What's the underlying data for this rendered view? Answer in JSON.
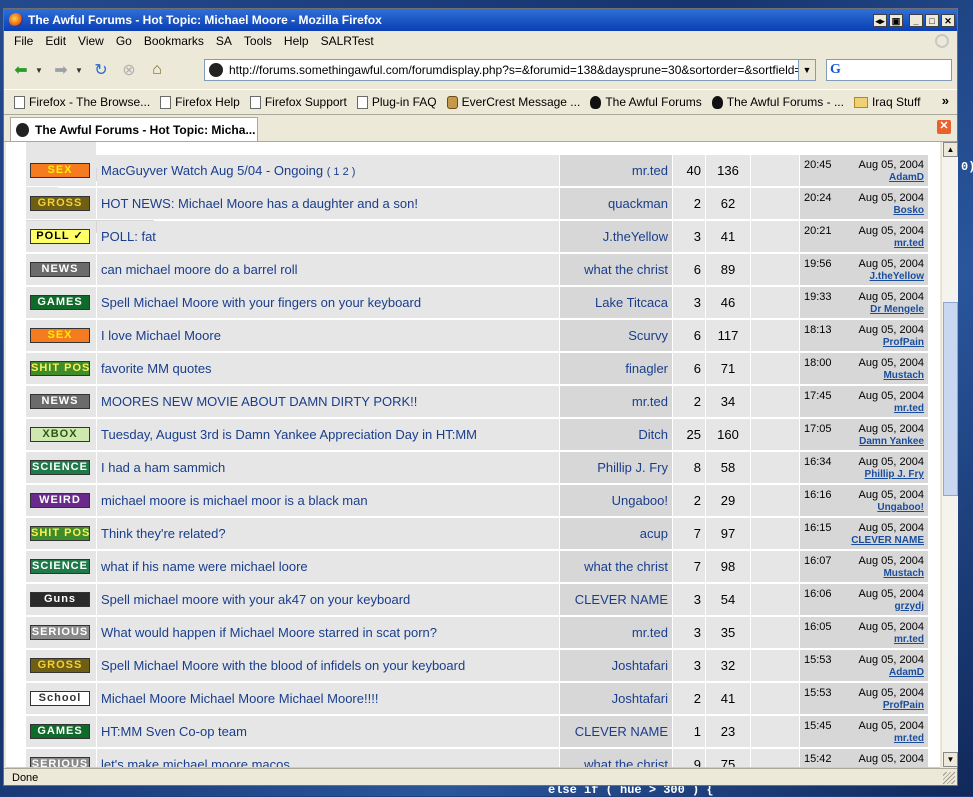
{
  "window": {
    "title": "The Awful Forums - Hot Topic: Michael Moore - Mozilla Firefox"
  },
  "menu": [
    "File",
    "Edit",
    "View",
    "Go",
    "Bookmarks",
    "SA",
    "Tools",
    "Help",
    "SALRTest"
  ],
  "address": {
    "url": "http://forums.somethingawful.com/forumdisplay.php?s=&forumid=138&daysprune=30&sortorder=&sortfield=lastpos"
  },
  "search": {
    "engine": "G"
  },
  "bookmarks": [
    "Firefox - The Browse...",
    "Firefox Help",
    "Firefox Support",
    "Plug-in FAQ",
    "EverCrest Message ...",
    "The Awful Forums",
    "The Awful Forums - ...",
    "Iraq Stuff"
  ],
  "tab": {
    "title": "The Awful Forums - Hot Topic: Micha..."
  },
  "threads": [
    {
      "icon": "SEX",
      "icon_bg": "#f47b20",
      "icon_fg": "#ffee00",
      "title": "MacGuyver Watch Aug 5/04 - Ongoing",
      "pages": "( 1 2 )",
      "user": "mr.ted",
      "replies": "40",
      "views": "136",
      "time": "20:45",
      "date": "Aug 05, 2004",
      "last": "AdamD"
    },
    {
      "icon": "GROSS",
      "icon_bg": "#6f5f12",
      "icon_fg": "#f2d23a",
      "title": "HOT NEWS: Michael Moore has a daughter and a son!",
      "pages": "",
      "user": "quackman",
      "replies": "2",
      "views": "62",
      "time": "20:24",
      "date": "Aug 05, 2004",
      "last": "Bosko"
    },
    {
      "icon": "POLL ✓",
      "icon_bg": "#ffff66",
      "icon_fg": "#000000",
      "title": "POLL: fat",
      "pages": "",
      "user": "J.theYellow",
      "replies": "3",
      "views": "41",
      "time": "20:21",
      "date": "Aug 05, 2004",
      "last": "mr.ted"
    },
    {
      "icon": "NEWS",
      "icon_bg": "#6b6b6b",
      "icon_fg": "#ffffff",
      "title": "can michael moore do a barrel roll",
      "pages": "",
      "user": "what the christ",
      "replies": "6",
      "views": "89",
      "time": "19:56",
      "date": "Aug 05, 2004",
      "last": "J.theYellow"
    },
    {
      "icon": "GAMES",
      "icon_bg": "#0f6b2a",
      "icon_fg": "#ffffff",
      "title": "Spell Michael Moore with your fingers on your keyboard",
      "pages": "",
      "user": "Lake Titcaca",
      "replies": "3",
      "views": "46",
      "time": "19:33",
      "date": "Aug 05, 2004",
      "last": "Dr Mengele"
    },
    {
      "icon": "SEX",
      "icon_bg": "#f47b20",
      "icon_fg": "#ffee00",
      "title": "I love Michael Moore",
      "pages": "",
      "user": "Scurvy",
      "replies": "6",
      "views": "117",
      "time": "18:13",
      "date": "Aug 05, 2004",
      "last": "ProfPain"
    },
    {
      "icon": "SHIT POST",
      "icon_bg": "#3f8c2a",
      "icon_fg": "#ffee55",
      "title": "favorite MM quotes",
      "pages": "",
      "user": "finagler",
      "replies": "6",
      "views": "71",
      "time": "18:00",
      "date": "Aug 05, 2004",
      "last": "Mustach"
    },
    {
      "icon": "NEWS",
      "icon_bg": "#6b6b6b",
      "icon_fg": "#ffffff",
      "title": "MOORES NEW MOVIE ABOUT DAMN DIRTY PORK!!",
      "pages": "",
      "user": "mr.ted",
      "replies": "2",
      "views": "34",
      "time": "17:45",
      "date": "Aug 05, 2004",
      "last": "mr.ted"
    },
    {
      "icon": "XBOX",
      "icon_bg": "#cfe8b0",
      "icon_fg": "#2a5a10",
      "title": "Tuesday, August 3rd is Damn Yankee Appreciation Day in HT:MM",
      "pages": "",
      "user": "Ditch",
      "replies": "25",
      "views": "160",
      "time": "17:05",
      "date": "Aug 05, 2004",
      "last": "Damn Yankee"
    },
    {
      "icon": "SCIENCE",
      "icon_bg": "#1f7a4a",
      "icon_fg": "#ffffff",
      "title": "I had a ham sammich",
      "pages": "",
      "user": "Phillip J. Fry",
      "replies": "8",
      "views": "58",
      "time": "16:34",
      "date": "Aug 05, 2004",
      "last": "Phillip J. Fry"
    },
    {
      "icon": "WEIRD",
      "icon_bg": "#6a2a8c",
      "icon_fg": "#ffffff",
      "title": "michael moore is michael moor is a black man",
      "pages": "",
      "user": "Ungaboo!",
      "replies": "2",
      "views": "29",
      "time": "16:16",
      "date": "Aug 05, 2004",
      "last": "Ungaboo!"
    },
    {
      "icon": "SHIT POST",
      "icon_bg": "#3f8c2a",
      "icon_fg": "#ffee55",
      "title": "Think they're related?",
      "pages": "",
      "user": "acup",
      "replies": "7",
      "views": "97",
      "time": "16:15",
      "date": "Aug 05, 2004",
      "last": "CLEVER NAME"
    },
    {
      "icon": "SCIENCE",
      "icon_bg": "#1f7a4a",
      "icon_fg": "#ffffff",
      "title": "what if his name were michael loore",
      "pages": "",
      "user": "what the christ",
      "replies": "7",
      "views": "98",
      "time": "16:07",
      "date": "Aug 05, 2004",
      "last": "Mustach"
    },
    {
      "icon": "Guns",
      "icon_bg": "#2a2a2a",
      "icon_fg": "#ffffff",
      "title": "Spell michael moore with your ak47 on your keyboard",
      "pages": "",
      "user": "CLEVER NAME",
      "replies": "3",
      "views": "54",
      "time": "16:06",
      "date": "Aug 05, 2004",
      "last": "grzydj"
    },
    {
      "icon": "SERIOUS",
      "icon_bg": "#8a8a8a",
      "icon_fg": "#ffffff",
      "title": "What would happen if Michael Moore starred in scat porn?",
      "pages": "",
      "user": "mr.ted",
      "replies": "3",
      "views": "35",
      "time": "16:05",
      "date": "Aug 05, 2004",
      "last": "mr.ted"
    },
    {
      "icon": "GROSS",
      "icon_bg": "#6f5f12",
      "icon_fg": "#f2d23a",
      "title": "Spell Michael Moore with the blood of infidels on your keyboard",
      "pages": "",
      "user": "Joshtafari",
      "replies": "3",
      "views": "32",
      "time": "15:53",
      "date": "Aug 05, 2004",
      "last": "AdamD"
    },
    {
      "icon": "School",
      "icon_bg": "#ffffff",
      "icon_fg": "#333333",
      "title": "Michael Moore Michael Moore Michael Moore!!!!",
      "pages": "",
      "user": "Joshtafari",
      "replies": "2",
      "views": "41",
      "time": "15:53",
      "date": "Aug 05, 2004",
      "last": "ProfPain"
    },
    {
      "icon": "GAMES",
      "icon_bg": "#0f6b2a",
      "icon_fg": "#ffffff",
      "title": "HT:MM Sven Co-op team",
      "pages": "",
      "user": "CLEVER NAME",
      "replies": "1",
      "views": "23",
      "time": "15:45",
      "date": "Aug 05, 2004",
      "last": "mr.ted"
    },
    {
      "icon": "SERIOUS",
      "icon_bg": "#8a8a8a",
      "icon_fg": "#ffffff",
      "title": "let's make michael moore macos",
      "pages": "",
      "user": "what the christ",
      "replies": "9",
      "views": "75",
      "time": "15:42",
      "date": "Aug 05, 2004",
      "last": ""
    }
  ],
  "status": {
    "text": "Done"
  },
  "desktop": {
    "code": "else if ( hue > 300 ) {",
    "glyph": "0)"
  }
}
